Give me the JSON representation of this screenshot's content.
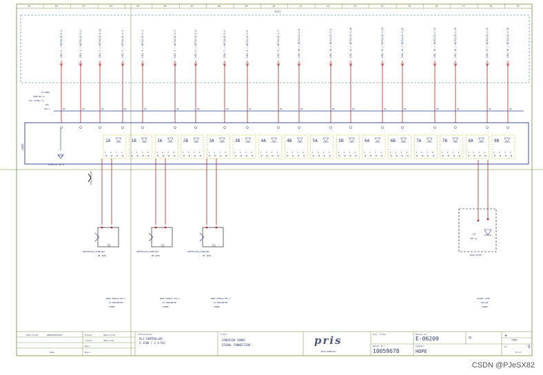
{
  "columns": [
    "01",
    "02",
    "03",
    "04",
    "05",
    "06",
    "07",
    "08",
    "09",
    "10",
    "11",
    "12",
    "13",
    "14",
    "15",
    "16",
    "17",
    "18",
    "19"
  ],
  "plc": {
    "top_label": "45712",
    "module_label": "-30XB5"
  },
  "coils": [
    {
      "text": "-COIL 1 / 46712/21.1.2",
      "signal": "SN"
    },
    {
      "text": "-COIL 1 / 46712/21.1.2",
      "signal": "SN"
    },
    {
      "text": "-COIL 3 / 46712/21.1.11",
      "signal": "SN"
    },
    {
      "text": "-COIL 3 / 46712/21.1.1",
      "signal": "SN"
    },
    {
      "text": "-COIL 4 / 46712/21.1.3",
      "signal": "SN"
    },
    {
      "text": "-COIL 5 / 46712/21.1.3",
      "signal": "SN"
    },
    {
      "text": "-COIL 6 / 46712/21.1.4",
      "signal": "SN"
    },
    {
      "text": "-COIL 7 / 46712/21.1.5",
      "signal": "SN"
    },
    {
      "text": "-COIL 8 / 46712/21.1.6",
      "signal": "SN"
    },
    {
      "text": "-COIL 9 / 46712/21.1.7",
      "signal": "SN"
    },
    {
      "text": "-COIL 10 / 46712/21.1.8",
      "signal": "SN"
    },
    {
      "text": "-COIL 11 / 46712/21.1.9",
      "signal": "SN"
    },
    {
      "text": "-COIL 12 / 46712/21.1.10",
      "signal": "SN"
    },
    {
      "text": "-COIL 13 / 46712/21.1.11",
      "signal": "SN"
    },
    {
      "text": "-COIL 14 / 46712/21.1.12",
      "signal": "SN"
    },
    {
      "text": "-COIL 15 / 46712/21.1.13",
      "signal": "SN"
    },
    {
      "text": "-COIL 16 / 46712/21.1.14",
      "signal": "SN"
    },
    {
      "text": "-COIL 17 / 46712/21.1.15",
      "signal": "SN"
    },
    {
      "text": "-COIL 18 / 46712/21.1.16",
      "signal": "SN"
    }
  ],
  "supply": {
    "lines": [
      "M_CONN8",
      "TERM.NR 21",
      "IOS TSTNGS 21",
      "RTS",
      "24V V"
    ]
  },
  "channels": [
    "1A",
    "1B",
    "2A",
    "2B",
    "3A",
    "3B",
    "4A",
    "4B",
    "5A",
    "5B",
    "6A",
    "6B",
    "7A",
    "7B",
    "8A",
    "8B"
  ],
  "connector": "ECP8-12-4P-Q",
  "sensors": [
    {
      "tag": "S1",
      "part": "GEETMS116A/16PB/QD4",
      "sub": "M8 4PIN",
      "note_lines": [
        "NODE MODULE POS.1",
        "IO PRESENTED",
        "CONN8"
      ]
    },
    {
      "tag": "S2",
      "part": "GEETMS116A/16PB/QD4",
      "sub": "M8 4PIN",
      "note_lines": [
        "NODE MODULE POS.2",
        "IO PRESENTED",
        "CONN8"
      ]
    },
    {
      "tag": "S3",
      "part": "GEETMS116A/16PB/QD4",
      "sub": "M8 4PIN",
      "note_lines": [
        "NODE MODULE POS.3",
        "IO PRESENTED",
        "CONN8"
      ]
    }
  ],
  "lamp": {
    "tag": "-TH",
    "sub": "LED yw",
    "part": "ESW1-D5YEH",
    "note_lines": [
      "SIGNAL LAMP",
      "YELLOW",
      "CONN8"
    ]
  },
  "title_block": {
    "date": "2021/11/10",
    "admin": "ADMINISTRATOR",
    "m_date_label": "M.Date:",
    "m_date": "2021/11/10",
    "c_date_label": "C.Date:",
    "c_date": "2021/7/22",
    "user_label": "User:",
    "name_label": "Name",
    "descr_label": "Descr.:",
    "install_label": "Installation:",
    "install_1": "PLC-CONTROLLER",
    "install_2": "S-1500 / 1-S-PLC",
    "title_label": "Title:",
    "title_1": "CONVEYOR CONOS",
    "title_2": "SIGNAL CONNECTION",
    "logo_text": "pris",
    "company": "PRIS ROBOTICS",
    "proj_label": "Proj. Title:",
    "order_label": "Reader Nr.:",
    "order_no": "10059678",
    "design_label": "Design no.:",
    "design_no": "E-06209",
    "company_label": "Company:",
    "company_name": "HOPE",
    "eq": "=",
    "plus": "+",
    "conn": "CONN8",
    "sheet_label": "St.",
    "sheet_no": "5",
    "sheet_total": "16 st."
  },
  "watermark": "CSDN @PJeSX82"
}
